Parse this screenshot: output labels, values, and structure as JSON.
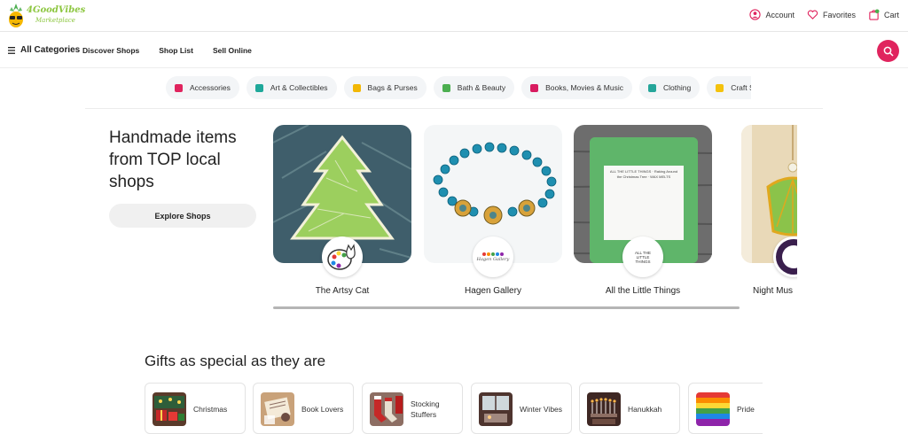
{
  "header": {
    "brand_line1": "4GoodVibes",
    "brand_line2": "Marketplace",
    "account_label": "Account",
    "favorites_label": "Favorites",
    "cart_label": "Cart"
  },
  "nav": {
    "all_categories": "All Categories",
    "links": [
      "Discover Shops",
      "Shop List",
      "Sell Online"
    ]
  },
  "categories": [
    {
      "label": "Accessories",
      "color": "#e0245e"
    },
    {
      "label": "Art & Collectibles",
      "color": "#1fa89a"
    },
    {
      "label": "Bags & Purses",
      "color": "#f2b705"
    },
    {
      "label": "Bath & Beauty",
      "color": "#4caf50"
    },
    {
      "label": "Books, Movies & Music",
      "color": "#d81b60"
    },
    {
      "label": "Clothing",
      "color": "#26a69a"
    },
    {
      "label": "Craft Su",
      "color": "#f4c20d"
    }
  ],
  "hero": {
    "title": "Handmade items from TOP local shops",
    "explore_label": "Explore Shops"
  },
  "shops": [
    {
      "name": "The Artsy Cat"
    },
    {
      "name": "Hagen Gallery",
      "badge_text": "Hagen Gallery"
    },
    {
      "name": "All the Little Things",
      "badge_text": "ALL THE LITTLE THINGS",
      "label_text": "ALL THE LITTLE THINGS · Raking Around the Christmas Tree · WAX MELTS"
    },
    {
      "name": "Night Mus"
    }
  ],
  "gifts": {
    "title": "Gifts as special as they are",
    "items": [
      {
        "label": "Christmas"
      },
      {
        "label": "Book Lovers"
      },
      {
        "label": "Stocking Stuffers"
      },
      {
        "label": "Winter Vibes"
      },
      {
        "label": "Hanukkah"
      },
      {
        "label": "Pride"
      }
    ]
  }
}
